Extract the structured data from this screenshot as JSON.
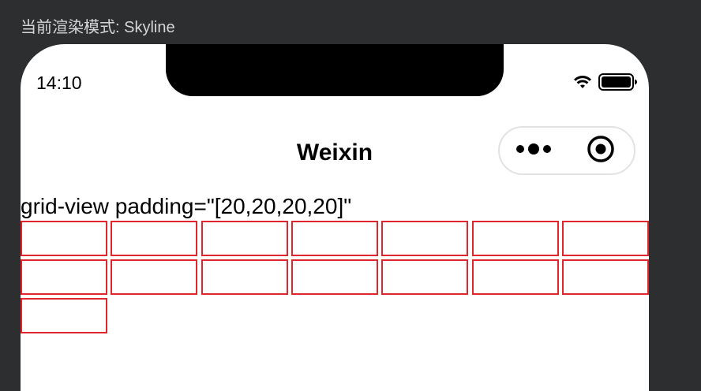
{
  "devtools": {
    "render_mode_label": "当前渲染模式: Skyline"
  },
  "status_bar": {
    "time": "14:10",
    "icons": [
      "wifi-icon",
      "battery-icon"
    ]
  },
  "nav_bar": {
    "title": "Weixin",
    "capsule_icons": [
      "more-icon",
      "close-target-icon"
    ]
  },
  "content": {
    "grid_label": "grid-view padding=\"[20,20,20,20]\"",
    "grid": {
      "columns": 7,
      "cell_count": 15,
      "border_color": "#e0262c"
    }
  }
}
